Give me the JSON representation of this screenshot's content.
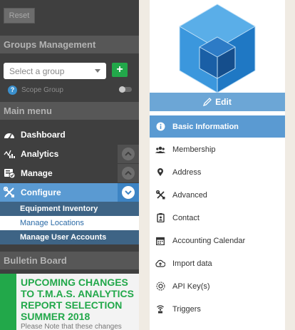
{
  "sidebar": {
    "reset_label": "Reset",
    "groups_header": "Groups Management",
    "group_select_placeholder": "Select a group",
    "add_label": "+",
    "scope_label": "Scope Group",
    "main_menu_header": "Main menu",
    "menu": [
      {
        "label": "Dashboard",
        "icon": "dashboard-icon"
      },
      {
        "label": "Analytics",
        "icon": "analytics-icon",
        "expander": "collapsed"
      },
      {
        "label": "Manage",
        "icon": "manage-icon",
        "expander": "collapsed"
      },
      {
        "label": "Configure",
        "icon": "configure-icon",
        "expander": "expanded",
        "active": true
      }
    ],
    "submenu": [
      {
        "label": "Equipment Inventory"
      },
      {
        "label": "Manage Locations",
        "current": true
      },
      {
        "label": "Manage User Accounts"
      }
    ],
    "bulletin_header": "Bulletin Board",
    "bulletin": {
      "title": "UPCOMING CHANGES TO T.M.A.S. ANALYTICS REPORT SELECTION SUMMER 2018",
      "text": "Please Note that these changes"
    }
  },
  "panel": {
    "edit_label": "Edit",
    "nav": [
      {
        "label": "Basic Information",
        "icon": "info-icon",
        "active": true
      },
      {
        "label": "Membership",
        "icon": "users-icon"
      },
      {
        "label": "Address",
        "icon": "location-pin-icon"
      },
      {
        "label": "Advanced",
        "icon": "tools-icon"
      },
      {
        "label": "Contact",
        "icon": "contact-icon"
      },
      {
        "label": "Accounting Calendar",
        "icon": "calendar-icon"
      },
      {
        "label": "Import data",
        "icon": "cloud-icon"
      },
      {
        "label": "API Key(s)",
        "icon": "api-key-icon"
      },
      {
        "label": "Triggers",
        "icon": "triggers-icon"
      }
    ]
  },
  "colors": {
    "accent_blue": "#5a9ad2",
    "green": "#22a84a",
    "sidebar_bg": "#3f3f3f",
    "page_bg": "#f0ebe3"
  }
}
